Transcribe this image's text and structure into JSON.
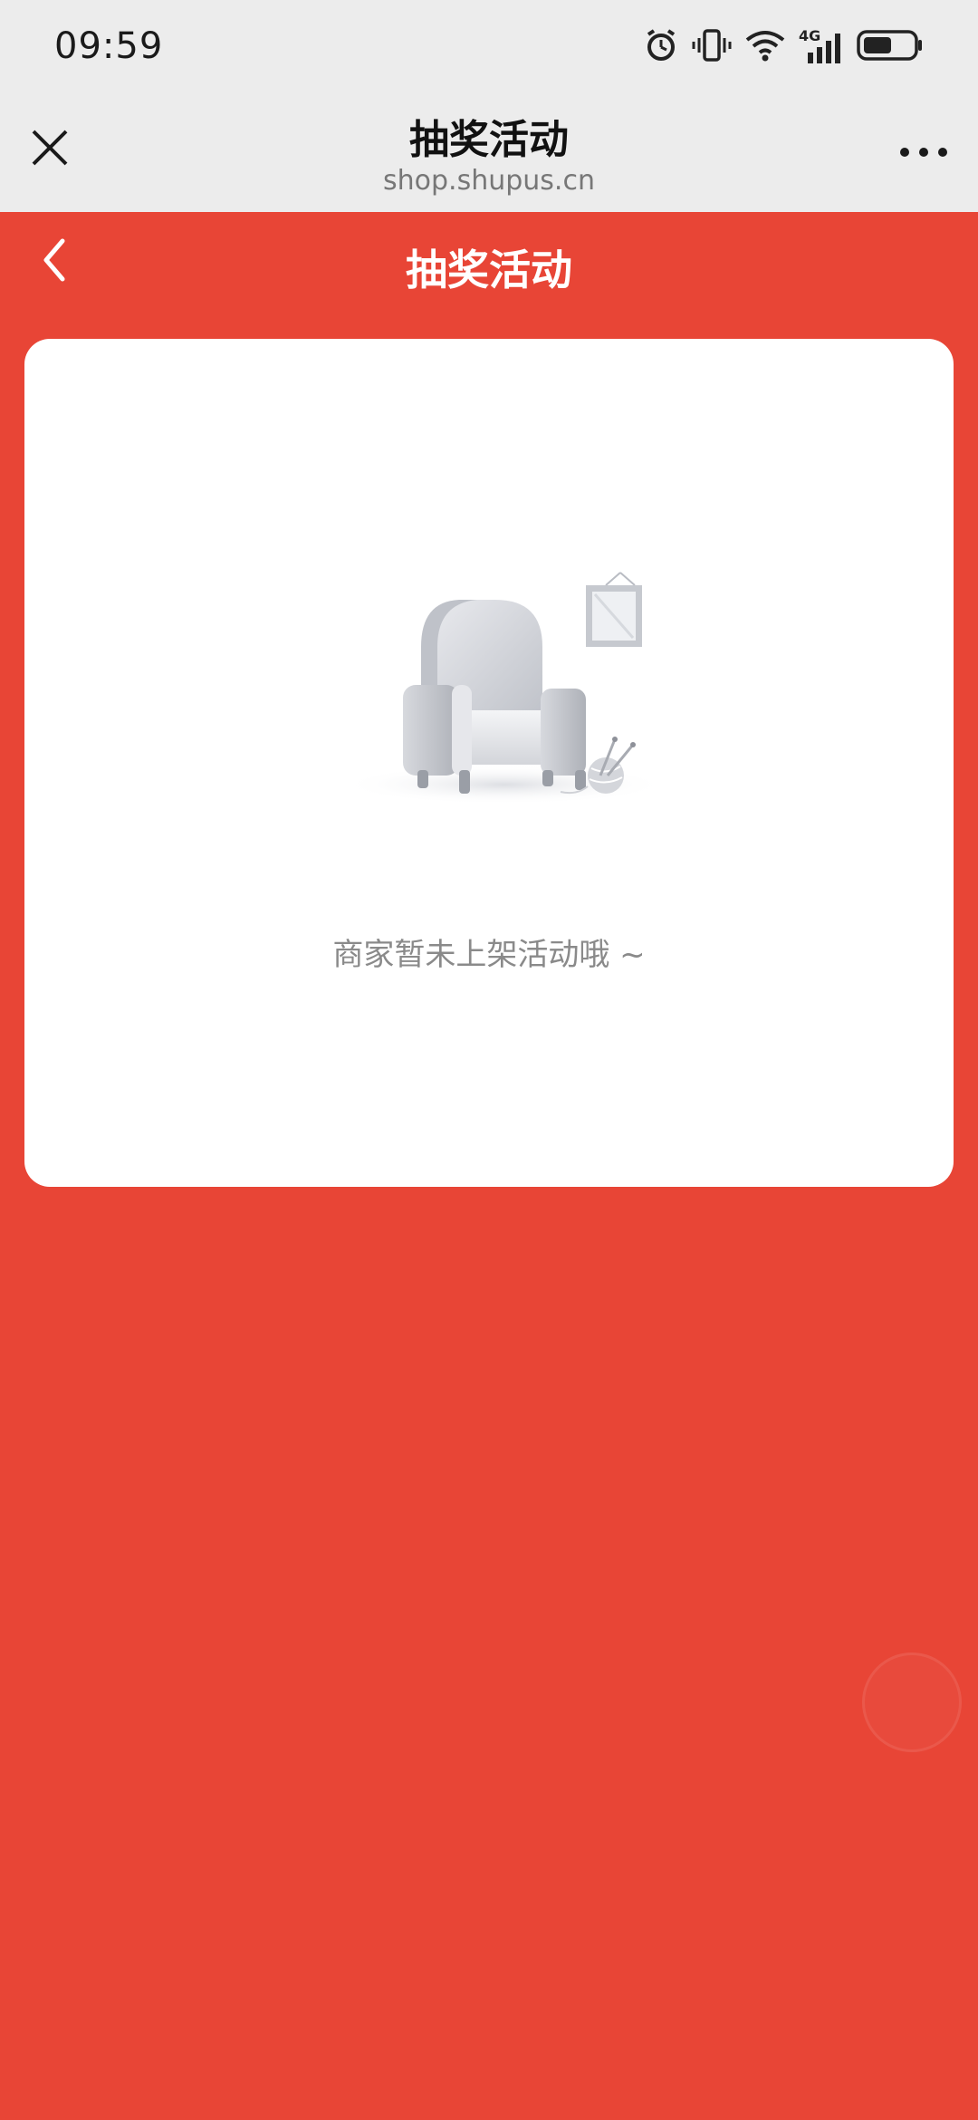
{
  "status_bar": {
    "time": "09:59",
    "network": "4G",
    "icons": [
      "alarm-icon",
      "vibrate-icon",
      "wifi-icon",
      "cellular-signal-icon",
      "battery-icon"
    ]
  },
  "webview": {
    "title": "抽奖活动",
    "url": "shop.shupus.cn",
    "close_icon": "close-icon",
    "more_icon": "more-dots-icon"
  },
  "page": {
    "title": "抽奖活动",
    "back_icon": "back-chevron-icon"
  },
  "empty_state": {
    "illustration": "empty-armchair-illustration",
    "message": "商家暂未上架活动哦 ~"
  },
  "colors": {
    "primary_red": "#e84536",
    "card": "#ffffff",
    "muted_text": "#8a8a8a",
    "bar_bg": "#ececec"
  }
}
